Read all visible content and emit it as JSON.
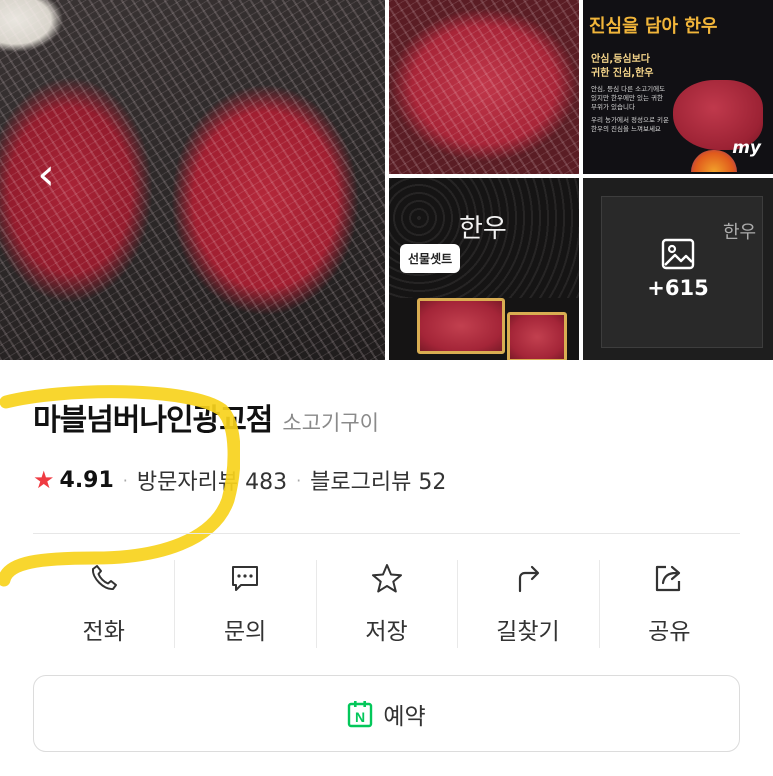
{
  "gallery": {
    "tiles": [
      {
        "name": "main-photo",
        "subject": "marbled beef steaks"
      },
      {
        "name": "photo-2",
        "subject": "sliced marbled beef"
      },
      {
        "name": "photo-3",
        "subject": "hanwoo poster"
      },
      {
        "name": "photo-4",
        "subject": "hanwoo gift box"
      },
      {
        "name": "photo-5",
        "subject": "gift box"
      }
    ],
    "poster": {
      "title": "진심을 담아 한우",
      "line1": "안심,등심보다",
      "line2": "귀한 진심,한우",
      "small1": "안심, 등심 다른 소고기에도 있지만 한우에만 있는 귀한 부위가 있습니다",
      "small2": "우리 농가에서 정성으로 키운 한우의 진심을 느껴보세요",
      "badge": "my"
    },
    "box_title": "한우",
    "gift_tag": "선물셋트",
    "more_count": "+615"
  },
  "place": {
    "name": "마블넘버나인광교점",
    "category": "소고기구이",
    "rating": "4.91",
    "visitor_reviews": "방문자리뷰 483",
    "blog_reviews": "블로그리뷰 52"
  },
  "actions": [
    {
      "label": "전화",
      "icon": "phone-icon"
    },
    {
      "label": "문의",
      "icon": "chat-icon"
    },
    {
      "label": "저장",
      "icon": "star-icon"
    },
    {
      "label": "길찾기",
      "icon": "directions-icon"
    },
    {
      "label": "공유",
      "icon": "share-icon"
    }
  ],
  "reserve": {
    "label": "예약",
    "icon": "naver-booking-icon",
    "icon_letter": "N"
  },
  "colors": {
    "star": "#ef3b42",
    "naver_green": "#03c75a",
    "highlight": "#f7d31c",
    "text_primary": "#111111",
    "text_secondary": "#8a8a8a"
  }
}
